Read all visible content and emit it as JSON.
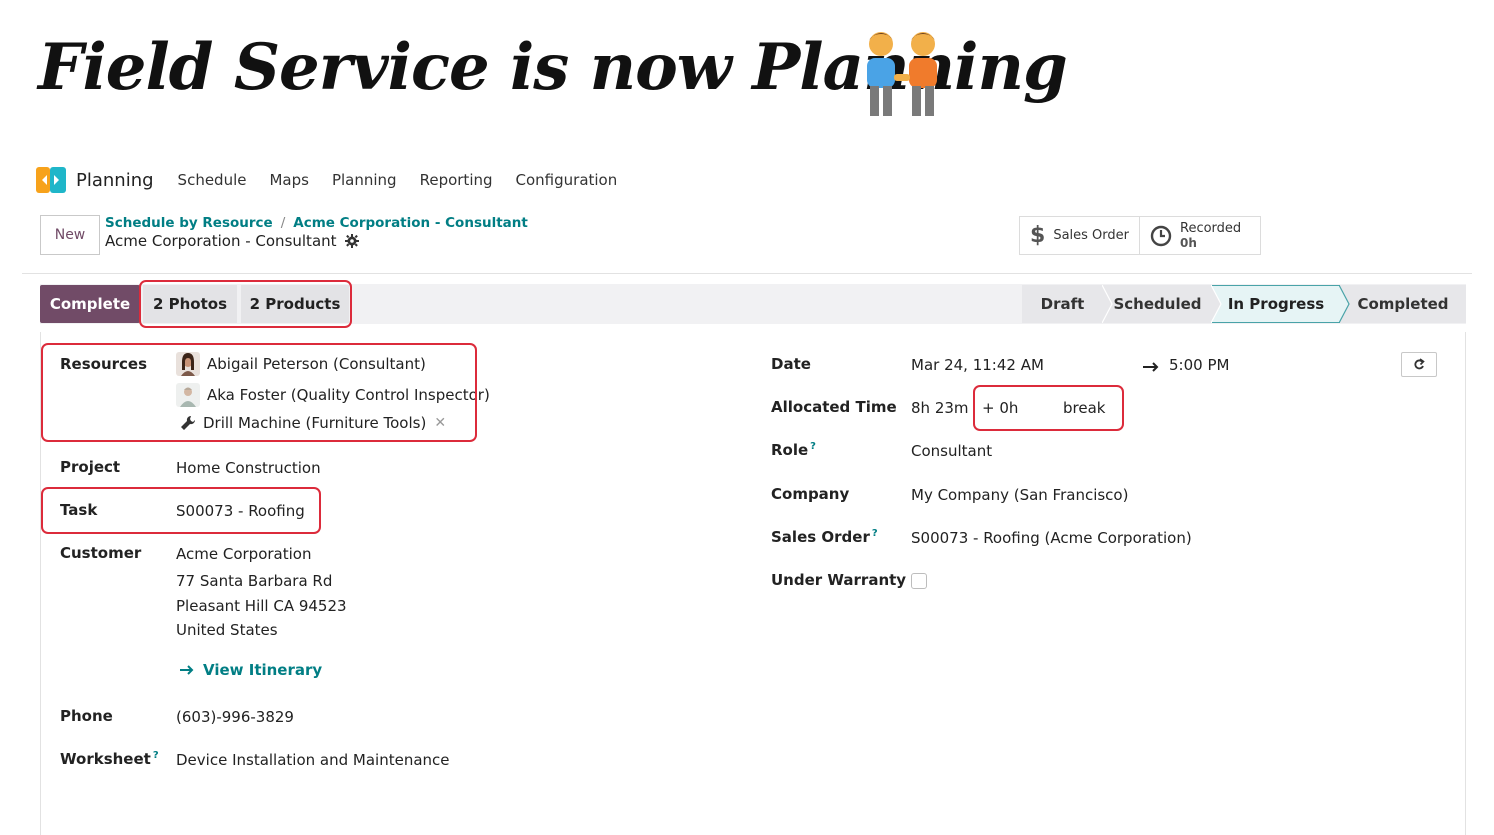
{
  "slide": {
    "title": "Field Service is now Planning"
  },
  "colors": {
    "brand": "#714b67",
    "link": "#017e84",
    "highlight": "#dc2b3b",
    "underline": "#3cc8a7"
  },
  "topnav": {
    "app_name": "Planning",
    "items": [
      "Schedule",
      "Maps",
      "Planning",
      "Reporting",
      "Configuration"
    ]
  },
  "control": {
    "new_label": "New",
    "breadcrumb": [
      "Schedule by Resource",
      "Acme Corporation - Consultant"
    ],
    "breadcrumb_sep": "/",
    "record_name": "Acme Corporation - Consultant"
  },
  "smart_buttons": {
    "sales_order": "Sales Order",
    "recorded_label": "Recorded",
    "recorded_value": "0h"
  },
  "actions": {
    "complete": "Complete",
    "photos": "2 Photos",
    "products": "2 Products"
  },
  "stages": [
    "Draft",
    "Scheduled",
    "In Progress",
    "Completed"
  ],
  "stage_active": "In Progress",
  "form_left": {
    "resources_label": "Resources",
    "resources": [
      "Abigail Peterson (Consultant)",
      "Aka Foster (Quality Control Inspector)",
      "Drill Machine (Furniture Tools)"
    ],
    "remove_glyph": "✕",
    "project_label": "Project",
    "project": "Home Construction",
    "task_label": "Task",
    "task": "S00073 - Roofing",
    "customer_label": "Customer",
    "customer_name": "Acme Corporation",
    "customer_street": "77 Santa Barbara Rd",
    "customer_city": "Pleasant Hill CA 94523",
    "customer_country": "United States",
    "itinerary": "View Itinerary",
    "phone_label": "Phone",
    "phone": "(603)-996-3829",
    "worksheet_label": "Worksheet",
    "worksheet": "Device Installation and Maintenance"
  },
  "form_right": {
    "date_label": "Date",
    "date_start": "Mar 24, 11:42 AM",
    "date_end": "5:00 PM",
    "allocated_label": "Allocated Time",
    "allocated": "8h 23m",
    "break_value": "+ 0h",
    "break_label": "break",
    "role_label": "Role",
    "role": "Consultant",
    "company_label": "Company",
    "company": "My Company (San Francisco)",
    "sales_order_label": "Sales Order",
    "sales_order": "S00073 - Roofing (Acme Corporation)",
    "warranty_label": "Under Warranty",
    "help_mark": "?"
  }
}
